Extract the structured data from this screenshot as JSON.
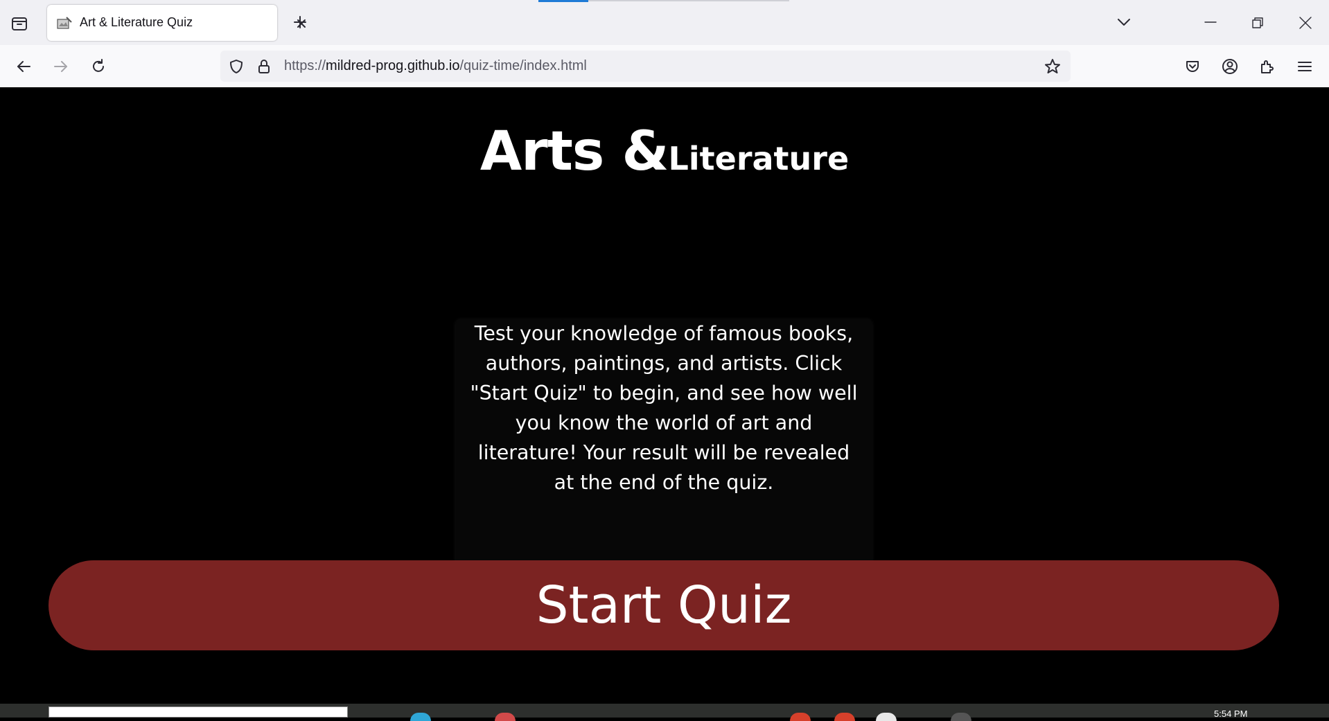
{
  "browser": {
    "tab": {
      "title": "Art & Literature Quiz",
      "favicon": "art-favicon-icon",
      "close_icon": "close-icon"
    },
    "new_tab_icon": "plus-icon",
    "tab_list_icon": "chevron-down-icon",
    "window_controls": [
      "minimize-icon",
      "restore-icon",
      "close-icon"
    ],
    "url": {
      "scheme": "https://",
      "host": "mildred-prog.github.io",
      "path": "/quiz-time/index.html"
    },
    "toolbar_icons": [
      "pocket-icon",
      "account-icon",
      "extensions-icon",
      "menu-icon"
    ]
  },
  "page": {
    "title_big": "Arts &",
    "title_small": "Literature",
    "intro": "Test your knowledge of famous books, authors, paintings, and artists. Click \"Start Quiz\" to begin, and see how well you know the world of art and literature! Your result will be revealed at the end of the quiz.",
    "start_button": "Start Quiz"
  },
  "colors": {
    "page_background": "#000000",
    "button_background": "#7b2322",
    "text": "#ffffff",
    "browser_chrome": "#f0f0f4"
  },
  "taskbar": {
    "clock": "5:54 PM"
  }
}
